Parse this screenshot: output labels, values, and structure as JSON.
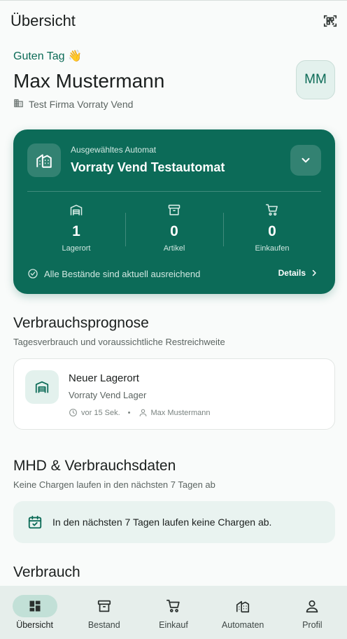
{
  "header": {
    "title": "Übersicht",
    "qr_icon": "qr-scan-icon"
  },
  "greeting": {
    "text": "Guten Tag 👋"
  },
  "user": {
    "name": "Max Mustermann",
    "company": "Test Firma Vorraty Vend",
    "initials": "MM"
  },
  "machine": {
    "label": "Ausgewähltes Automat",
    "name": "Vorraty Vend Testautomat",
    "stats": [
      {
        "icon": "warehouse-icon",
        "value": "1",
        "label": "Lagerort"
      },
      {
        "icon": "archive-box-icon",
        "value": "0",
        "label": "Artikel"
      },
      {
        "icon": "cart-icon",
        "value": "0",
        "label": "Einkaufen"
      }
    ],
    "status": "Alle Bestände sind aktuell ausreichend",
    "details_label": "Details"
  },
  "forecast": {
    "title": "Verbrauchsprognose",
    "subtitle": "Tagesverbrauch und voraussichtliche Restreichweite",
    "item": {
      "title": "Neuer Lagerort",
      "subtitle": "Vorraty Vend Lager",
      "time": "vor 15 Sek.",
      "user": "Max Mustermann"
    }
  },
  "mhd": {
    "title": "MHD & Verbrauchsdaten",
    "subtitle": "Keine Chargen laufen in den nächsten 7 Tagen ab",
    "info": "In den nächsten 7 Tagen laufen keine Chargen ab."
  },
  "consumption": {
    "title": "Verbrauch"
  },
  "nav": [
    {
      "label": "Übersicht",
      "icon": "dashboard-icon",
      "active": true
    },
    {
      "label": "Bestand",
      "icon": "archive-box-icon",
      "active": false
    },
    {
      "label": "Einkauf",
      "icon": "cart-icon",
      "active": false
    },
    {
      "label": "Automaten",
      "icon": "building-icon",
      "active": false
    },
    {
      "label": "Profil",
      "icon": "person-icon",
      "active": false
    }
  ],
  "colors": {
    "primary": "#0c6b58",
    "accent_text": "#0c6b57",
    "surface": "#f9fbfa",
    "nav_bg": "#e6eeeb",
    "nav_active": "#c2e0d7",
    "info_bg": "#e9f3f0"
  }
}
